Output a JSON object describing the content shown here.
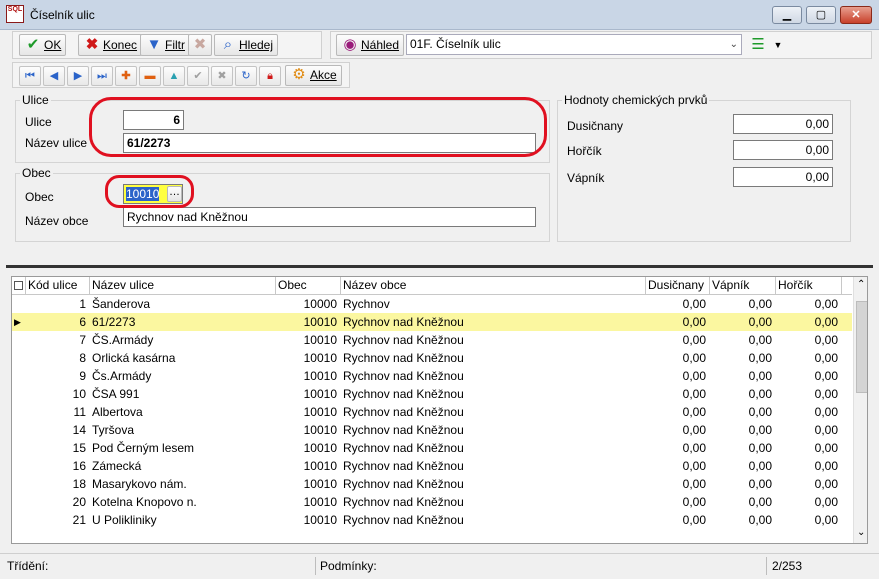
{
  "window": {
    "title": "Číselník ulic",
    "app_icon_text": "SQL"
  },
  "toolbar": {
    "ok_label": "OK",
    "konec_label": "Konec",
    "filtr_label": "Filtr",
    "hledej_label": "Hledej",
    "nahled_label": "Náhled",
    "akce_label": "Akce",
    "report_selected": "01F. Číselník ulic"
  },
  "ulice_group": {
    "legend": "Ulice",
    "ulice_label": "Ulice",
    "ulice_value": "6",
    "nazev_label": "Název ulice",
    "nazev_value": "61/2273"
  },
  "obec_group": {
    "legend": "Obec",
    "obec_label": "Obec",
    "obec_value": "10010",
    "nazev_label": "Název obce",
    "nazev_value": "Rychnov nad Kněžnou"
  },
  "chem_group": {
    "legend": "Hodnoty chemických prvků",
    "dusicnany_label": "Dusičnany",
    "dusicnany_value": "0,00",
    "horcik_label": "Hořčík",
    "horcik_value": "0,00",
    "vapnik_label": "Vápník",
    "vapnik_value": "0,00"
  },
  "grid": {
    "headers": [
      "Kód ulice",
      "Název ulice",
      "Obec",
      "Název obce",
      "Dusičnany",
      "Vápník",
      "Hořčík"
    ],
    "rows": [
      [
        "1",
        "Šanderova",
        "10000",
        "Rychnov",
        "0,00",
        "0,00",
        "0,00"
      ],
      [
        "6",
        "61/2273",
        "10010",
        "Rychnov nad Kněžnou",
        "0,00",
        "0,00",
        "0,00"
      ],
      [
        "7",
        "ČS.Armády",
        "10010",
        "Rychnov nad Kněžnou",
        "0,00",
        "0,00",
        "0,00"
      ],
      [
        "8",
        "Orlická kasárna",
        "10010",
        "Rychnov nad Kněžnou",
        "0,00",
        "0,00",
        "0,00"
      ],
      [
        "9",
        "Čs.Armády",
        "10010",
        "Rychnov nad Kněžnou",
        "0,00",
        "0,00",
        "0,00"
      ],
      [
        "10",
        "ČSA 991",
        "10010",
        "Rychnov nad Kněžnou",
        "0,00",
        "0,00",
        "0,00"
      ],
      [
        "11",
        "Albertova",
        "10010",
        "Rychnov nad Kněžnou",
        "0,00",
        "0,00",
        "0,00"
      ],
      [
        "14",
        "Tyršova",
        "10010",
        "Rychnov nad Kněžnou",
        "0,00",
        "0,00",
        "0,00"
      ],
      [
        "15",
        "Pod Černým lesem",
        "10010",
        "Rychnov nad Kněžnou",
        "0,00",
        "0,00",
        "0,00"
      ],
      [
        "16",
        "Zámecká",
        "10010",
        "Rychnov nad Kněžnou",
        "0,00",
        "0,00",
        "0,00"
      ],
      [
        "18",
        "Masarykovo nám.",
        "10010",
        "Rychnov nad Kněžnou",
        "0,00",
        "0,00",
        "0,00"
      ],
      [
        "20",
        "Kotelna Knopovo n.",
        "10010",
        "Rychnov nad Kněžnou",
        "0,00",
        "0,00",
        "0,00"
      ],
      [
        "21",
        "U Polikliniky",
        "10010",
        "Rychnov nad Kněžnou",
        "0,00",
        "0,00",
        "0,00"
      ]
    ],
    "selected_index": 1
  },
  "status": {
    "trideni": "Třídění:",
    "podminky": "Podmínky:",
    "record": "2/253"
  },
  "colors": {
    "selected_row": "#fbf7a0",
    "highlight_ring": "#e01020",
    "ok_icon": "#1e9a2a",
    "konec_icon": "#d01818"
  }
}
